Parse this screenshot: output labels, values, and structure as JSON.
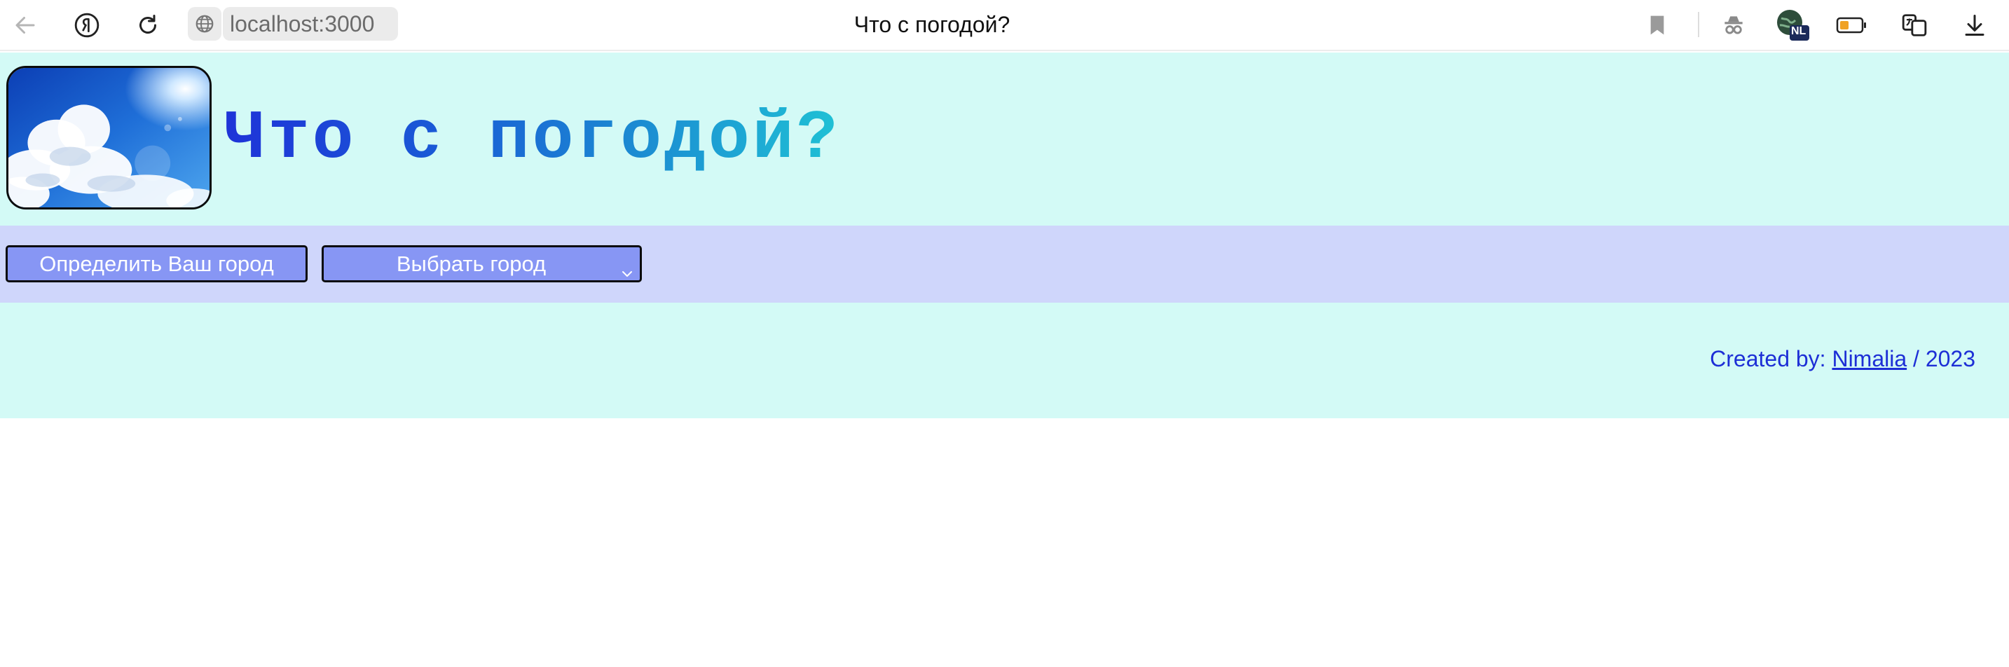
{
  "browser": {
    "url": "localhost:3000",
    "tab_title": "Что с погодой?",
    "profile_badge": "NL",
    "icons": [
      "back-arrow-icon",
      "yandex-icon",
      "reload-icon",
      "globe-icon",
      "bookmark-icon",
      "incognito-icon",
      "profile-globe-icon",
      "battery-icon",
      "translate-icon",
      "download-icon"
    ]
  },
  "header": {
    "title": "Что с погодой?",
    "logo": "sky-clouds-image"
  },
  "controls": {
    "detect_label": "Определить Ваш город",
    "select_value": "Выбрать город"
  },
  "footer": {
    "prefix": "Created by: ",
    "author": "Nimalia",
    "suffix": " / 2023"
  },
  "colors": {
    "header_bg": "#d3faf6",
    "controls_bg": "#cfd6fb",
    "button_bg": "#8796f4",
    "title_gradient_start": "#1e33d8",
    "title_gradient_end": "#1fc1d5",
    "credit_text": "#1d2fd6"
  }
}
